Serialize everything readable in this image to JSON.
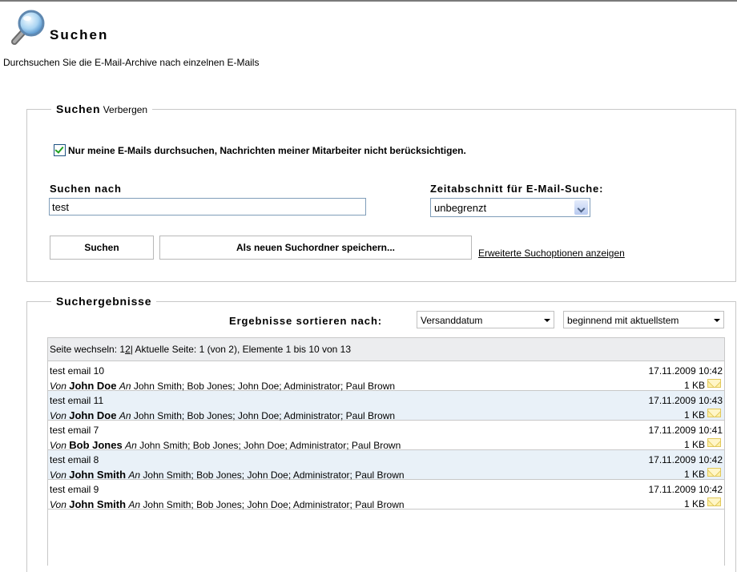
{
  "header": {
    "title": "Suchen",
    "subtitle": "Durchsuchen Sie die E-Mail-Archive nach einzelnen E-Mails"
  },
  "search_panel": {
    "legend_title": "Suchen",
    "legend_toggle": "Verbergen",
    "checkbox_label": "Nur meine E-Mails durchsuchen, Nachrichten meiner Mitarbeiter nicht berücksichtigen.",
    "checkbox_checked": true,
    "search_label": "Suchen nach",
    "search_value": "test",
    "period_label": "Zeitabschnitt für E-Mail-Suche:",
    "period_value": "unbegrenzt",
    "search_button": "Suchen",
    "save_button": "Als neuen Suchordner speichern...",
    "advanced_link": "Erweiterte Suchoptionen anzeigen"
  },
  "results_panel": {
    "legend_title": "Suchergebnisse",
    "sort_label": "Ergebnisse sortieren nach:",
    "sort_by": "Versanddatum",
    "sort_order": "beginnend mit aktuellstem",
    "pager": {
      "prefix": "Seite wechseln: 1 ",
      "page2": "2",
      "suffix": " | Aktuelle Seite: 1 (von 2), Elemente 1 bis 10 von 13"
    },
    "von_label": "Von",
    "an_label": "An",
    "rows": [
      {
        "subject": "test email 10",
        "date": "17.11.2009 10:42",
        "from": "John Doe",
        "to": "John Smith; Bob Jones; John Doe; Administrator; Paul Brown",
        "size": "1 KB"
      },
      {
        "subject": "test email 11",
        "date": "17.11.2009 10:43",
        "from": "John Doe",
        "to": "John Smith; Bob Jones; John Doe; Administrator; Paul Brown",
        "size": "1 KB"
      },
      {
        "subject": "test email 7",
        "date": "17.11.2009 10:41",
        "from": "Bob Jones",
        "to": "John Smith; Bob Jones; John Doe; Administrator; Paul Brown",
        "size": "1 KB"
      },
      {
        "subject": "test email 8",
        "date": "17.11.2009 10:42",
        "from": "John Smith",
        "to": "John Smith; Bob Jones; John Doe; Administrator; Paul Brown",
        "size": "1 KB"
      },
      {
        "subject": "test email 9",
        "date": "17.11.2009 10:42",
        "from": "John Smith",
        "to": "John Smith; Bob Jones; John Doe; Administrator; Paul Brown",
        "size": "1 KB"
      }
    ]
  },
  "colors": {
    "row_alt": "#e9f1f8",
    "pager_bg": "#ecedef",
    "border": "#c8c8c8",
    "envelope": "#fff1a8"
  },
  "icons": {
    "page_icon": "magnifier-icon",
    "row_icon": "envelope-icon",
    "checkbox_icon": "checkmark-icon"
  }
}
